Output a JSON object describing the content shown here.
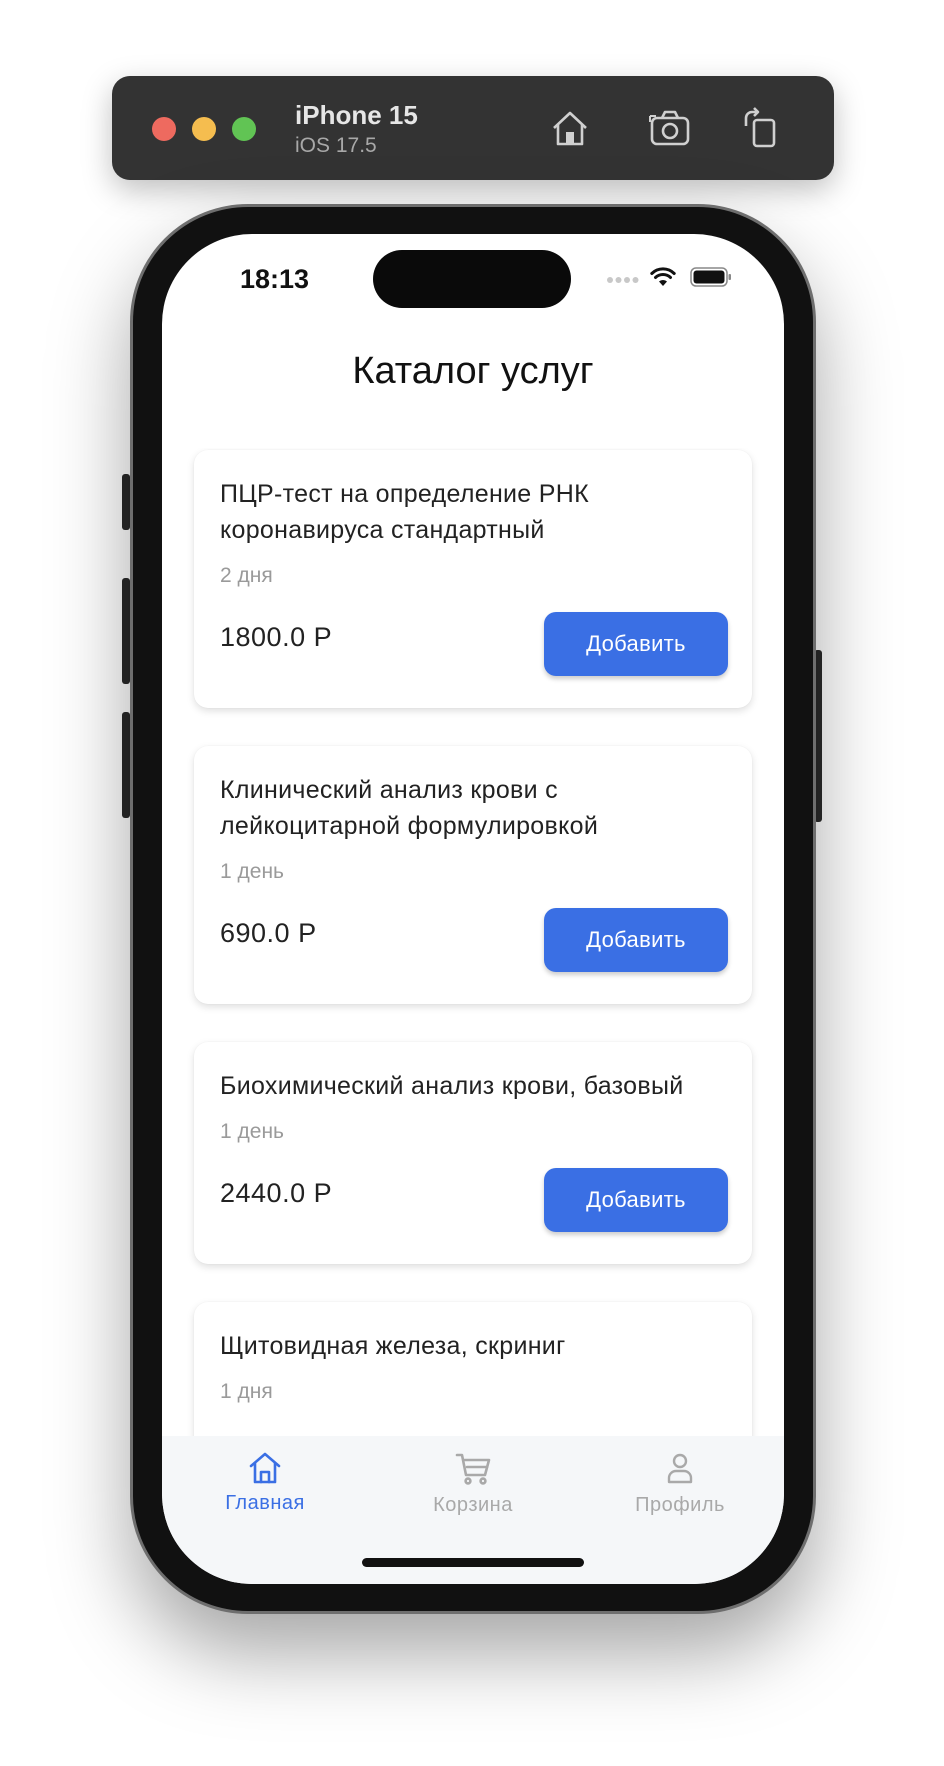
{
  "simulator": {
    "device_name": "iPhone 15",
    "os_version": "iOS 17.5",
    "icons": [
      "home-icon",
      "screenshot-icon",
      "rotate-icon"
    ]
  },
  "status_bar": {
    "time": "18:13",
    "icons": [
      "cellular-dots-icon",
      "wifi-icon",
      "battery-icon"
    ]
  },
  "page": {
    "title": "Каталог услуг"
  },
  "services": [
    {
      "title": "ПЦР-тест на определение РНК коронавируса стандартный",
      "duration": "2 дня",
      "price": "1800.0 Р",
      "button": "Добавить"
    },
    {
      "title": "Клинический анализ крови с лейкоцитарной формулировкой",
      "duration": "1 день",
      "price": "690.0 Р",
      "button": "Добавить"
    },
    {
      "title": "Биохимический анализ крови, базовый",
      "duration": "1 день",
      "price": "2440.0 Р",
      "button": "Добавить"
    },
    {
      "title": "Щитовидная железа, скриниг",
      "duration": "1 дня"
    }
  ],
  "nav": {
    "active_color": "#3a6fe4",
    "inactive_color": "#a9a9a9",
    "items": [
      {
        "label": "Главная",
        "icon": "home-icon",
        "active": true
      },
      {
        "label": "Корзина",
        "icon": "cart-icon",
        "active": false
      },
      {
        "label": "Профиль",
        "icon": "profile-icon",
        "active": false
      }
    ]
  },
  "colors": {
    "button": "#3a6fe4",
    "toolbar": "#333333"
  }
}
